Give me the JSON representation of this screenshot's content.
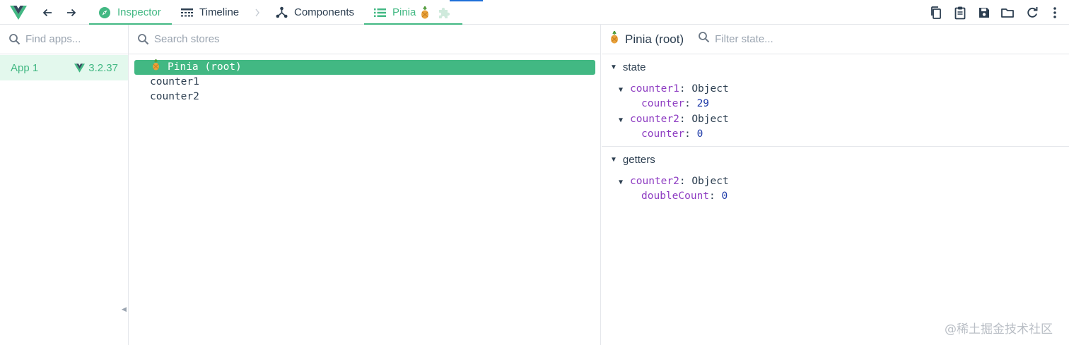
{
  "toolbar": {
    "tabs": [
      {
        "label": "Inspector"
      },
      {
        "label": "Timeline"
      },
      {
        "label": "Components"
      },
      {
        "label": "Pinia"
      }
    ],
    "accent_color": "#42b883"
  },
  "apps_pane": {
    "search_placeholder": "Find apps...",
    "apps": [
      {
        "name": "App 1",
        "version": "3.2.37"
      }
    ]
  },
  "stores_pane": {
    "search_placeholder": "Search stores",
    "stores": [
      {
        "label": "Pinia (root)",
        "selected": true
      },
      {
        "label": "counter1",
        "selected": false
      },
      {
        "label": "counter2",
        "selected": false
      }
    ]
  },
  "state_pane": {
    "title": "Pinia (root)",
    "filter_placeholder": "Filter state...",
    "sections": [
      {
        "name": "state",
        "entries": [
          {
            "key": "counter1",
            "type": "Object",
            "children": [
              {
                "key": "counter",
                "value": "29"
              }
            ]
          },
          {
            "key": "counter2",
            "type": "Object",
            "children": [
              {
                "key": "counter",
                "value": "0"
              }
            ]
          }
        ]
      },
      {
        "name": "getters",
        "entries": [
          {
            "key": "counter2",
            "type": "Object",
            "children": [
              {
                "key": "doubleCount",
                "value": "0"
              }
            ]
          }
        ]
      }
    ]
  },
  "watermark": "@稀土掘金技术社区"
}
